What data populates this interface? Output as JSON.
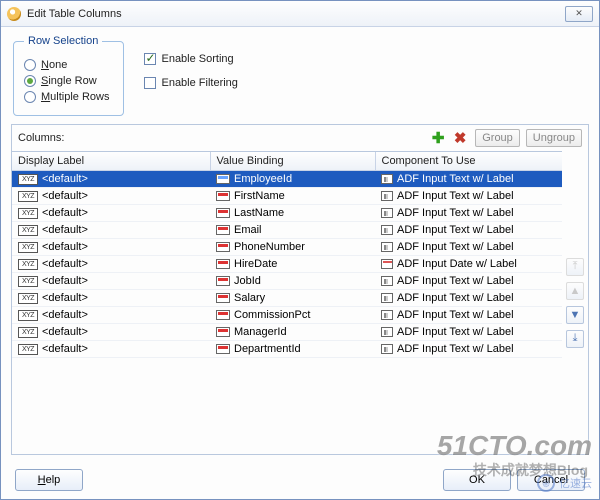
{
  "window": {
    "title": "Edit Table Columns",
    "close": "✕"
  },
  "rowSelection": {
    "legend": "Row Selection",
    "none": "None",
    "single": "Single Row",
    "multiple": "Multiple Rows",
    "selected": "single"
  },
  "options": {
    "enableSorting": {
      "label": "Enable Sorting",
      "checked": true
    },
    "enableFiltering": {
      "label": "Enable Filtering",
      "checked": false
    }
  },
  "columnsPanel": {
    "label": "Columns:",
    "group": "Group",
    "ungroup": "Ungroup"
  },
  "headers": {
    "displayLabel": "Display Label",
    "valueBinding": "Value Binding",
    "componentToUse": "Component To Use"
  },
  "rows": [
    {
      "label": "<default>",
      "binding": "EmployeeId",
      "component": "ADF Input Text w/ Label",
      "ctype": "text",
      "selected": true
    },
    {
      "label": "<default>",
      "binding": "FirstName",
      "component": "ADF Input Text w/ Label",
      "ctype": "text",
      "selected": false
    },
    {
      "label": "<default>",
      "binding": "LastName",
      "component": "ADF Input Text w/ Label",
      "ctype": "text",
      "selected": false
    },
    {
      "label": "<default>",
      "binding": "Email",
      "component": "ADF Input Text w/ Label",
      "ctype": "text",
      "selected": false
    },
    {
      "label": "<default>",
      "binding": "PhoneNumber",
      "component": "ADF Input Text w/ Label",
      "ctype": "text",
      "selected": false
    },
    {
      "label": "<default>",
      "binding": "HireDate",
      "component": "ADF Input Date w/ Label",
      "ctype": "date",
      "selected": false
    },
    {
      "label": "<default>",
      "binding": "JobId",
      "component": "ADF Input Text w/ Label",
      "ctype": "text",
      "selected": false
    },
    {
      "label": "<default>",
      "binding": "Salary",
      "component": "ADF Input Text w/ Label",
      "ctype": "text",
      "selected": false
    },
    {
      "label": "<default>",
      "binding": "CommissionPct",
      "component": "ADF Input Text w/ Label",
      "ctype": "text",
      "selected": false
    },
    {
      "label": "<default>",
      "binding": "ManagerId",
      "component": "ADF Input Text w/ Label",
      "ctype": "text",
      "selected": false
    },
    {
      "label": "<default>",
      "binding": "DepartmentId",
      "component": "ADF Input Text w/ Label",
      "ctype": "text",
      "selected": false
    }
  ],
  "footer": {
    "help": "Help",
    "ok": "OK",
    "cancel": "Cancel"
  },
  "watermarks": {
    "w1": "51CTO.com",
    "w2": "技术成就梦想Blog",
    "w3": "亿速云"
  }
}
